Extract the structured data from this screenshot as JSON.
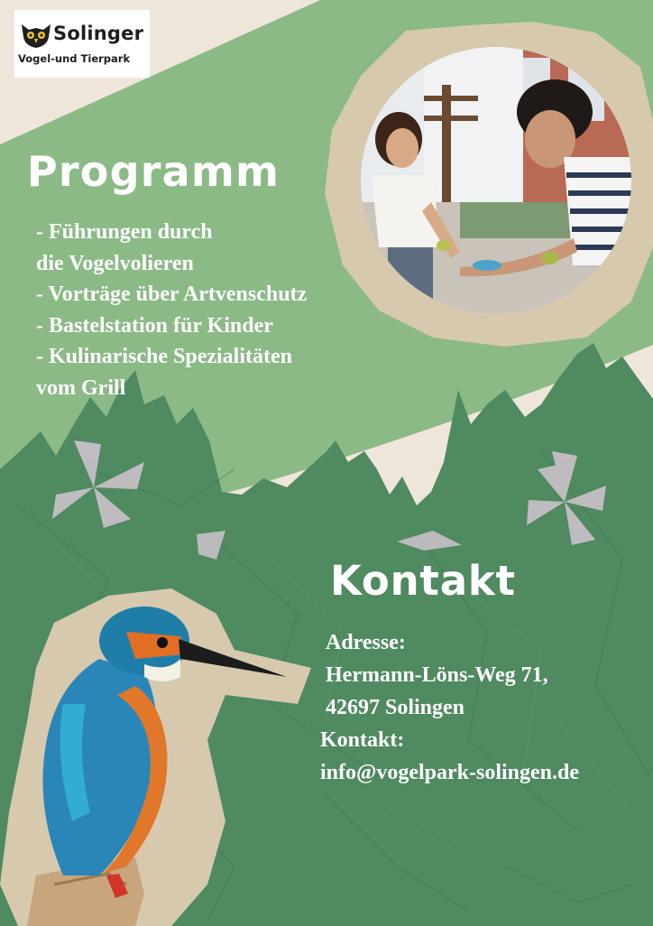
{
  "logo": {
    "name": "Solinger",
    "subtitle": "Vogel-und Tierpark",
    "icon": "owl-icon"
  },
  "program": {
    "title": "Programm",
    "items": [
      "- Führungen durch",
      "die Vogelvolieren",
      "- Vorträge über Artvenschutz",
      "- Bastelstation für Kinder",
      "- Kulinarische Spezialitäten",
      "vom Grill"
    ]
  },
  "contact": {
    "title": "Kontakt",
    "address_label": "Adresse:",
    "street": "Hermann-Löns-Weg 71,",
    "city": "42697 Solingen",
    "contact_label": "Kontakt:",
    "email": "info@vogelpark-solingen.de"
  },
  "colors": {
    "light_green": "#8bba86",
    "dark_green": "#4f8a60",
    "cream": "#efe6db",
    "paper": "#d7c9ae",
    "flower": "#c6bfc6"
  },
  "images": {
    "family_photo": "photo-girl-and-woman-feeding-birds",
    "kingfisher": "kingfisher-bird-cutout"
  }
}
